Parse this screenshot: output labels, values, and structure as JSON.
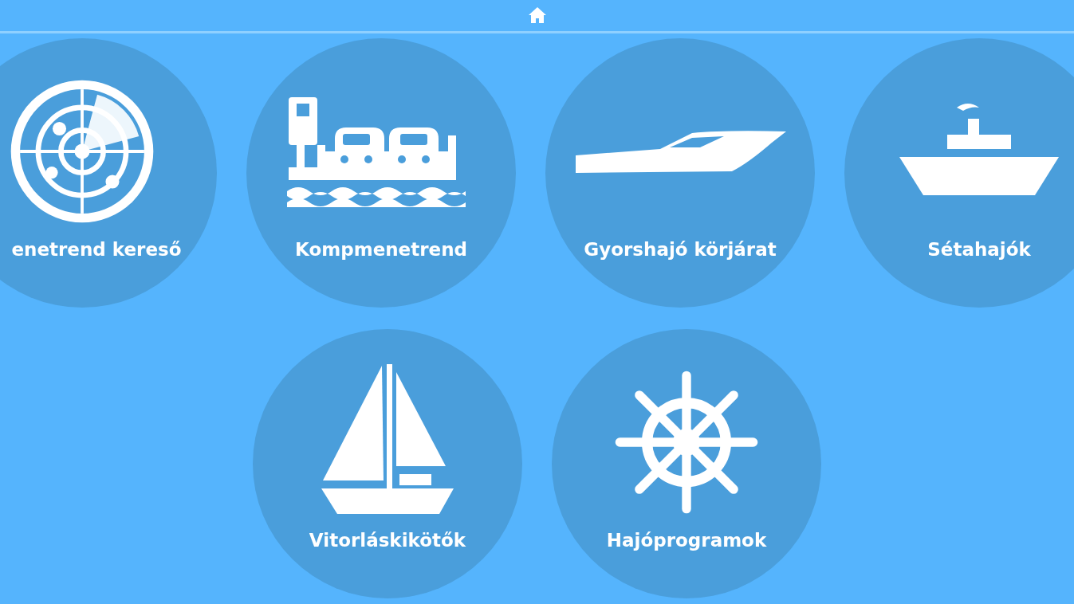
{
  "menu_items": [
    {
      "label": "enetrend kereső"
    },
    {
      "label": "Kompmenetrend"
    },
    {
      "label": "Gyorshajó körjárat"
    },
    {
      "label": "Sétahajók"
    },
    {
      "label": "Vitorláskikötők"
    },
    {
      "label": "Hajóprogramok"
    }
  ]
}
